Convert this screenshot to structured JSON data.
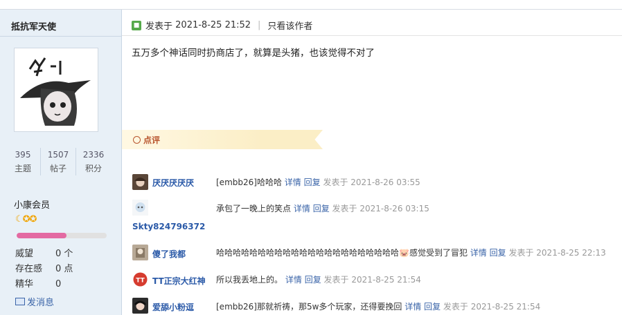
{
  "author": {
    "name": "抵抗军天使",
    "stats": [
      {
        "value": "395",
        "label": "主题"
      },
      {
        "value": "1507",
        "label": "帖子"
      },
      {
        "value": "2336",
        "label": "积分"
      }
    ],
    "group": "小康会员",
    "stars": "☾✪✪",
    "progress": 0.55,
    "info": [
      {
        "key": "威望",
        "value": "0 个"
      },
      {
        "key": "存在感",
        "value": "0 点"
      },
      {
        "key": "精华",
        "value": "0"
      }
    ],
    "message_label": "发消息"
  },
  "post": {
    "posted_prefix": "发表于",
    "posted_time": "2021-8-25 21:52",
    "only_author": "只看该作者",
    "content": "五万多个神话同时扔商店了，就算是头猪，也该觉得不对了"
  },
  "dianping_label": "点评",
  "comments": [
    {
      "user": "厌厌厌厌厌",
      "text": "[embb26]哈哈哈",
      "detail": "详情",
      "reply": "回复",
      "time": "发表于 2021-8-26 03:55"
    },
    {
      "user": "Skty824796372",
      "text": "承包了一晚上的笑点",
      "detail": "详情",
      "reply": "回复",
      "time": "发表于 2021-8-26 03:15"
    },
    {
      "user": "傻了我都",
      "text": "哈哈哈哈哈哈哈哈哈哈哈哈哈哈哈哈哈哈哈哈哈哈🐷感觉受到了冒犯",
      "detail": "详情",
      "reply": "回复",
      "time": "发表于 2021-8-25 22:13"
    },
    {
      "user": "TT正宗大红神",
      "text": "所以我丢地上的。",
      "detail": "详情",
      "reply": "回复",
      "time": "发表于 2021-8-25 21:54"
    },
    {
      "user": "爱舔小粉逗",
      "text": "[embb26]那就祈祷，那5w多个玩家，还得要挽回",
      "detail": "详情",
      "reply": "回复",
      "time": "发表于 2021-8-25 21:54"
    }
  ]
}
